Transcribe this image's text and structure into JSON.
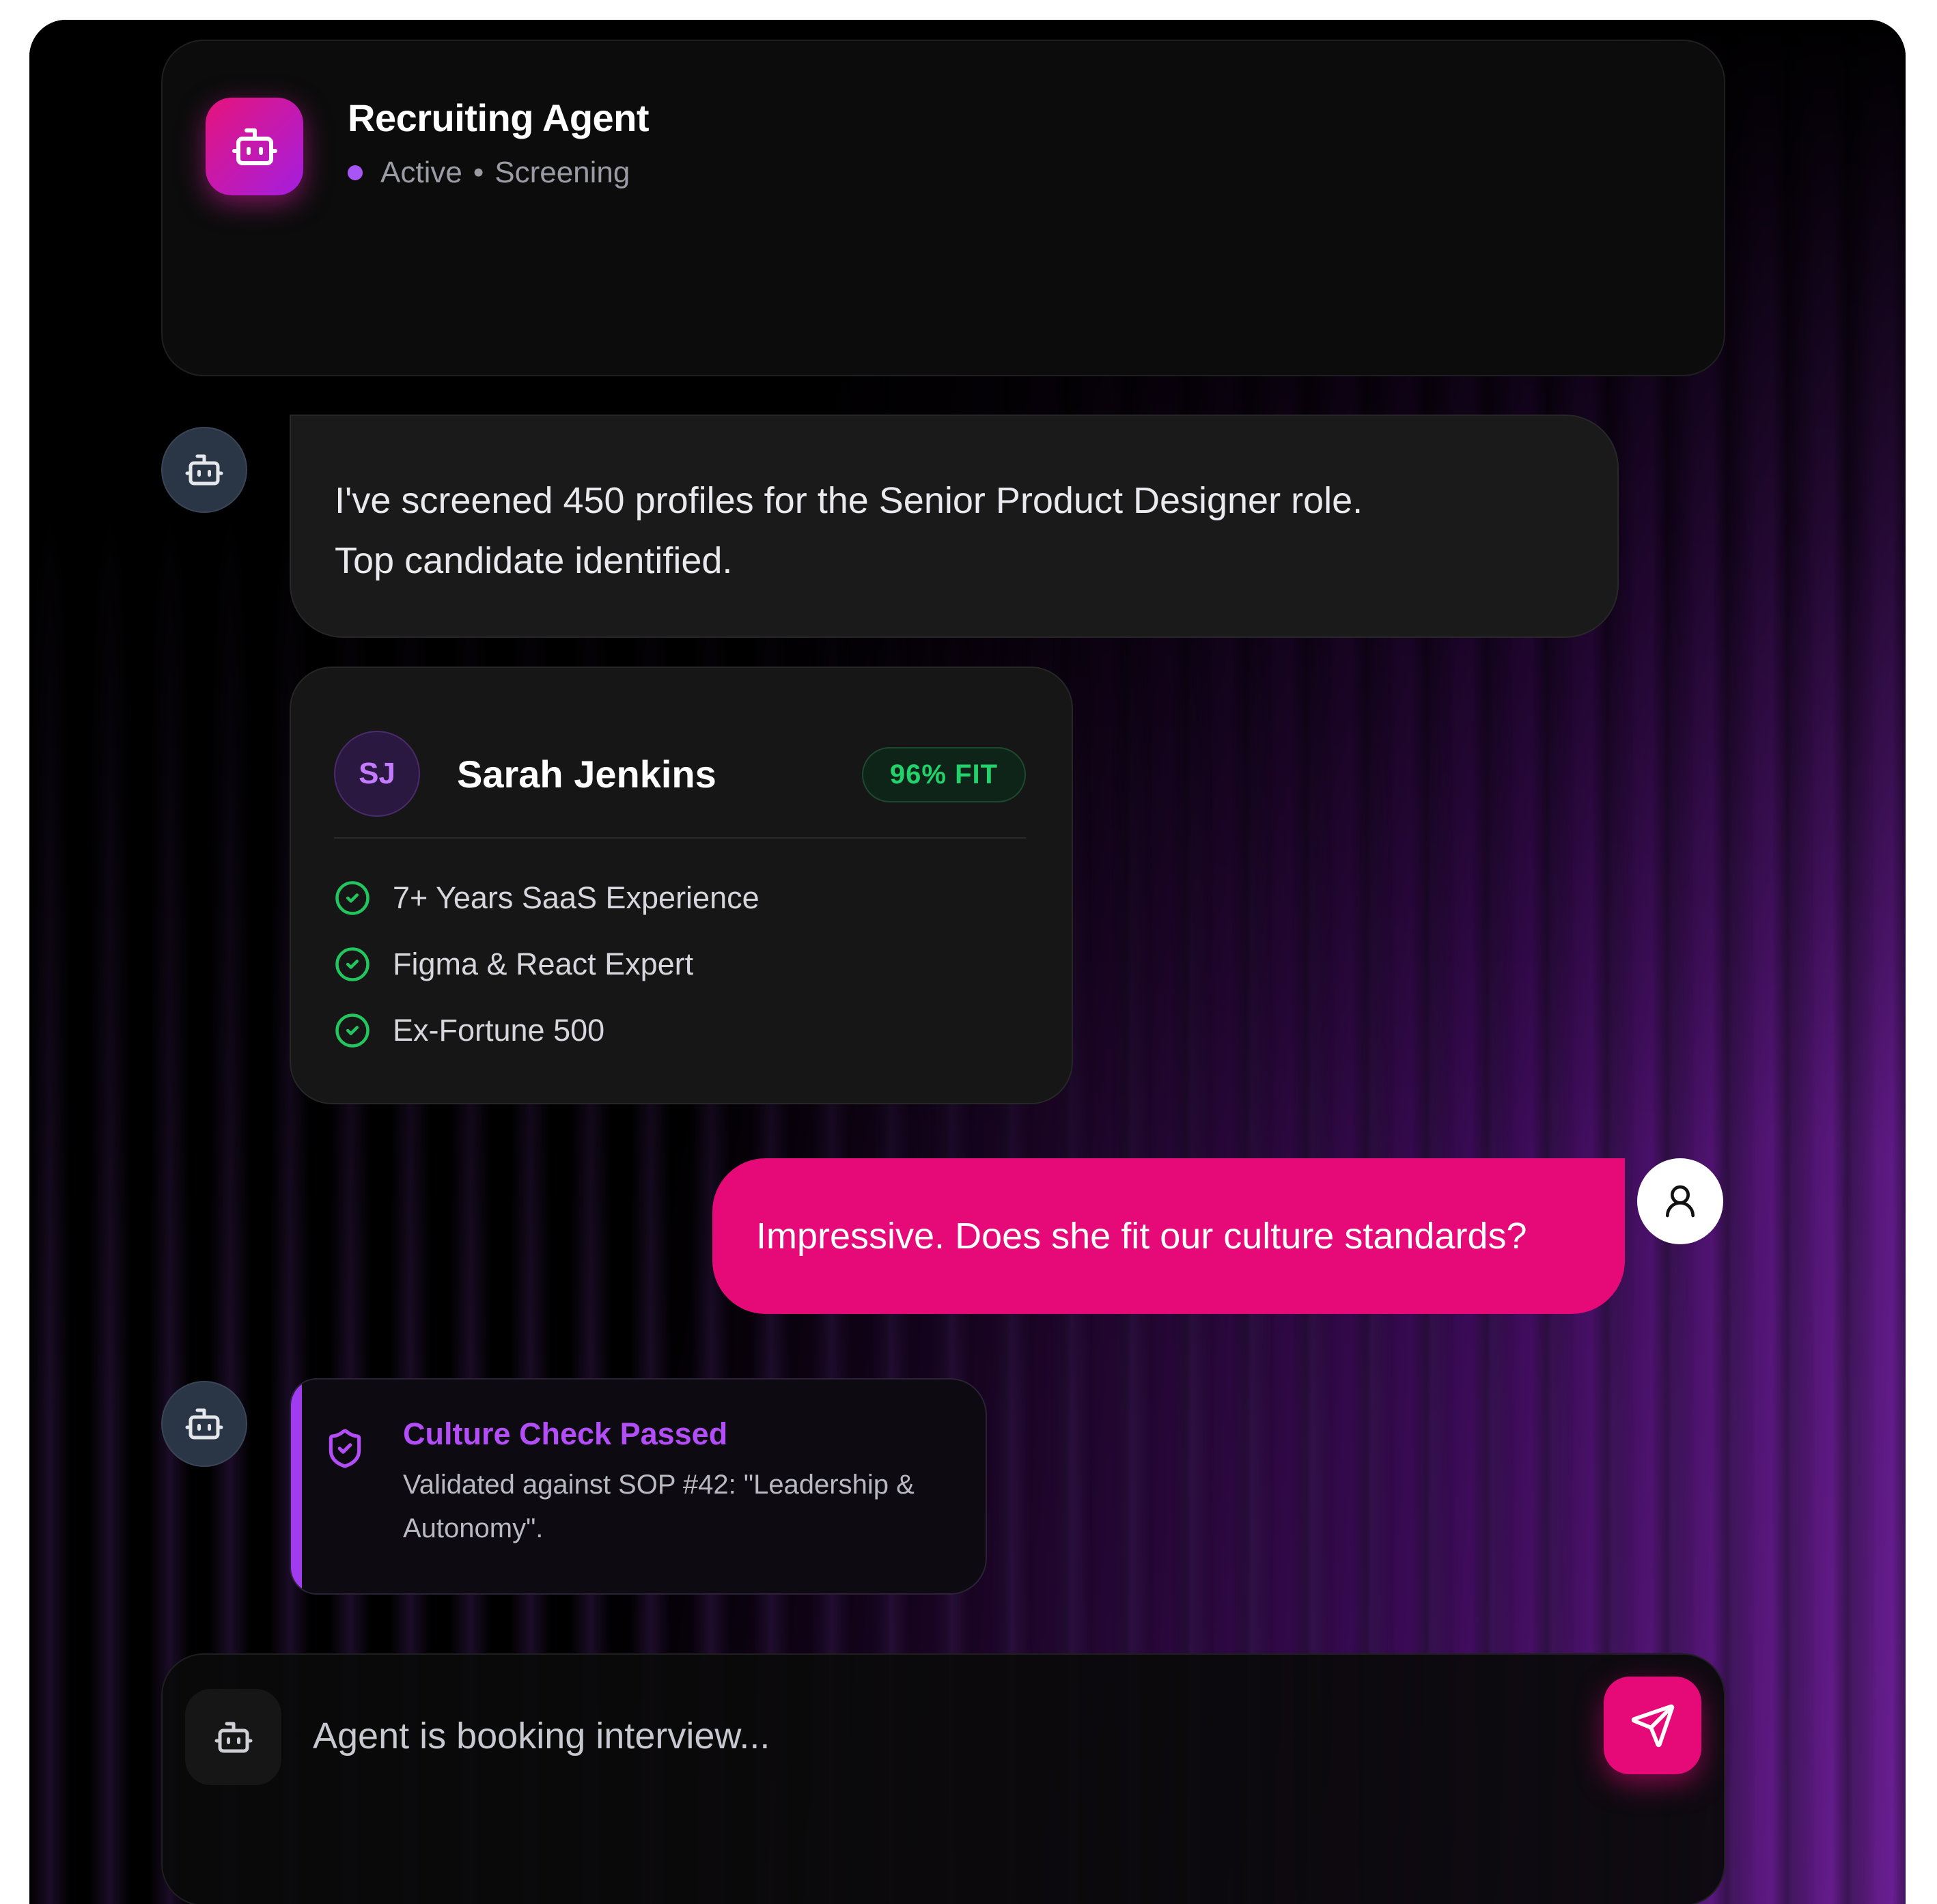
{
  "header": {
    "agent_name": "Recruiting Agent",
    "status": "Active",
    "separator": "•",
    "mode": "Screening"
  },
  "messages": {
    "agent_intro_line1": "I've screened 450 profiles for the Senior Product Designer role.",
    "agent_intro_line2": "Top candidate identified.",
    "user_question": "Impressive. Does she fit our culture standards?"
  },
  "candidate": {
    "initials": "SJ",
    "name": "Sarah Jenkins",
    "fit_badge": "96% FIT",
    "skills": [
      "7+ Years SaaS Experience",
      "Figma & React Expert",
      "Ex-Fortune 500"
    ]
  },
  "culture_check": {
    "title": "Culture Check Passed",
    "text": "Validated against SOP #42: \"Leadership & Autonomy\"."
  },
  "input": {
    "text": "Agent is booking interview..."
  },
  "icons": {
    "agent_logo": "bot-icon",
    "bot_avatar": "bot-icon",
    "user_avatar": "user-icon",
    "skill_check": "check-circle-icon",
    "culture": "shield-check-icon",
    "send": "send-icon"
  },
  "colors": {
    "accent_pink": "#e60a78",
    "accent_purple": "#a855f7",
    "fit_green": "#22d36b",
    "background": "#000000"
  }
}
